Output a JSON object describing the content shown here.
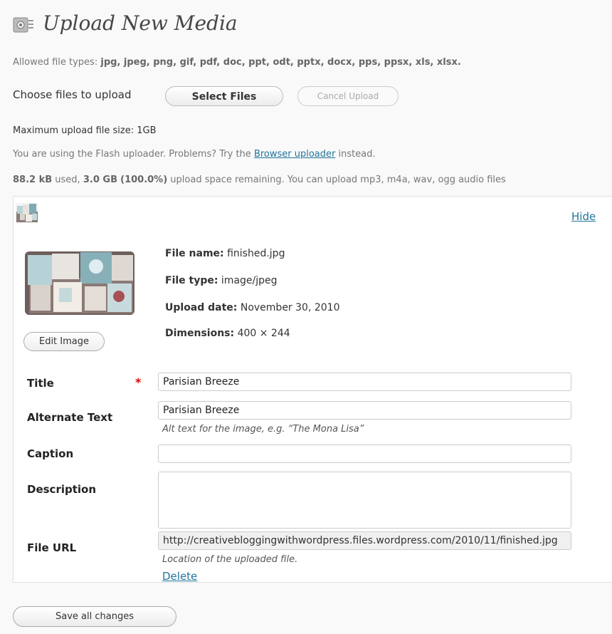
{
  "page": {
    "title": "Upload New Media",
    "icon": "media-upload-icon"
  },
  "upload": {
    "allowed_label": "Allowed file types:",
    "allowed_types": "jpg, jpeg, png, gif, pdf, doc, ppt, odt, pptx, docx, pps, ppsx, xls, xlsx.",
    "choose_label": "Choose files to upload",
    "select_button": "Select Files",
    "cancel_button": "Cancel Upload",
    "max_size": "Maximum upload file size: 1GB",
    "flash_prefix": "You are using the Flash uploader. Problems? Try the",
    "flash_link": "Browser uploader",
    "flash_suffix": "instead.",
    "space_used": "88.2 kB",
    "space_used_suffix": "used,",
    "space_remaining": "3.0 GB",
    "space_percent": "(100.0%)",
    "space_suffix": "upload space remaining. You can upload mp3, m4a, wav, ogg audio files"
  },
  "item": {
    "hide_link": "Hide",
    "edit_image_button": "Edit Image",
    "file_name_label": "File name:",
    "file_name": "finished.jpg",
    "file_type_label": "File type:",
    "file_type": "image/jpeg",
    "upload_date_label": "Upload date:",
    "upload_date": "November 30, 2010",
    "dimensions_label": "Dimensions:",
    "dimensions": "400 × 244",
    "fields": {
      "title_label": "Title",
      "title_required": "*",
      "title_value": "Parisian Breeze",
      "alt_label": "Alternate Text",
      "alt_value": "Parisian Breeze",
      "alt_help": "Alt text for the image, e.g. “The Mona Lisa”",
      "caption_label": "Caption",
      "caption_value": "",
      "description_label": "Description",
      "description_value": "",
      "url_label": "File URL",
      "url_value": "http://creativebloggingwithwordpress.files.wordpress.com/2010/11/finished.jpg",
      "url_help": "Location of the uploaded file."
    },
    "delete_link": "Delete"
  },
  "footer": {
    "save_button": "Save all changes"
  }
}
